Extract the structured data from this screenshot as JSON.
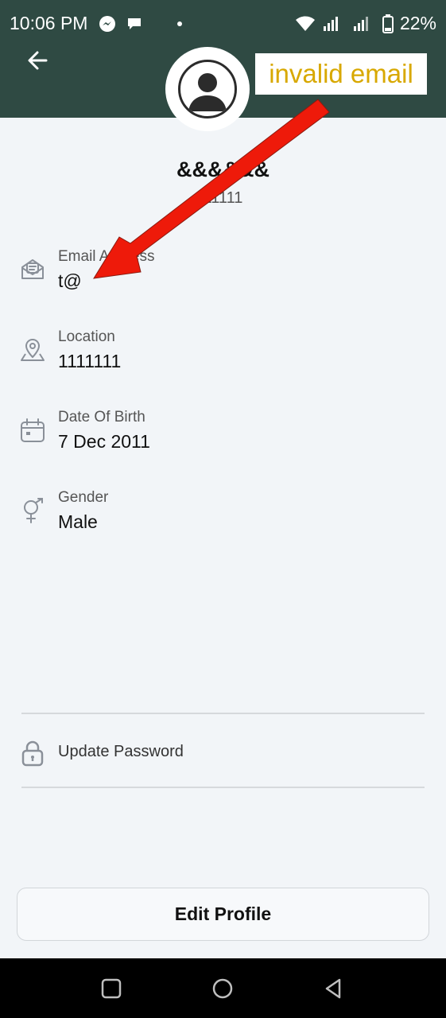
{
  "status_bar": {
    "time": "10:06 PM",
    "battery": "22%"
  },
  "header": {
    "back_icon": "arrow-left-icon"
  },
  "annotation": {
    "text": "invalid email",
    "color": "#d8a800",
    "arrow_color": "#ee1a0a"
  },
  "profile": {
    "name": "&&&&&&",
    "phone": "11111"
  },
  "fields": [
    {
      "label": "Email Address",
      "value": "t@",
      "icon": "mail-icon"
    },
    {
      "label": "Location",
      "value": "1111111",
      "icon": "location-icon"
    },
    {
      "label": "Date Of Birth",
      "value": "7 Dec 2011",
      "icon": "calendar-icon"
    },
    {
      "label": "Gender",
      "value": "Male",
      "icon": "gender-icon"
    }
  ],
  "update_password": {
    "label": "Update Password",
    "icon": "lock-icon"
  },
  "edit_profile": {
    "label": "Edit Profile"
  },
  "colors": {
    "header_bg": "#2f4a43",
    "page_bg": "#f2f5f8"
  }
}
